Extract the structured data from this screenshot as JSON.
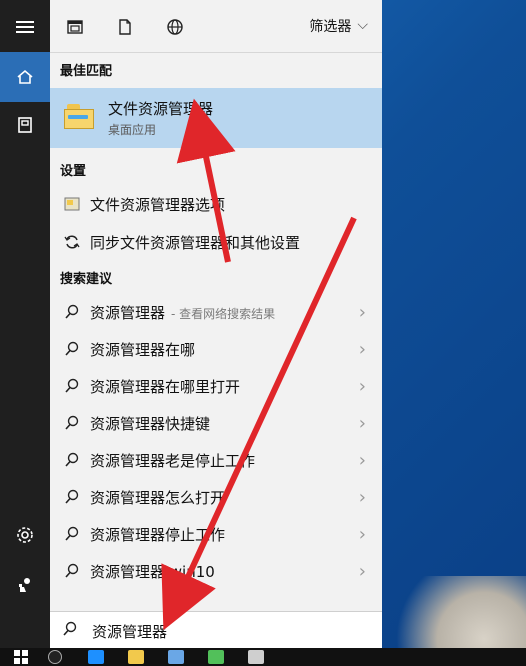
{
  "header": {
    "filter_label": "筛选器"
  },
  "sections": {
    "best_match": "最佳匹配",
    "settings": "设置",
    "search_suggestions": "搜索建议"
  },
  "best_match": {
    "title": "文件资源管理器",
    "subtitle": "桌面应用"
  },
  "settings_items": [
    {
      "label": "文件资源管理器选项"
    },
    {
      "label": "同步文件资源管理器和其他设置"
    }
  ],
  "suggestions": [
    {
      "label": "资源管理器",
      "suffix": "- 查看网络搜索结果"
    },
    {
      "label": "资源管理器在哪",
      "suffix": ""
    },
    {
      "label": "资源管理器在哪里打开",
      "suffix": ""
    },
    {
      "label": "资源管理器快捷键",
      "suffix": ""
    },
    {
      "label": "资源管理器老是停止工作",
      "suffix": ""
    },
    {
      "label": "资源管理器怎么打开",
      "suffix": ""
    },
    {
      "label": "资源管理器停止工作",
      "suffix": ""
    },
    {
      "label": "资源管理器 win10",
      "suffix": ""
    }
  ],
  "search": {
    "value": "资源管理器"
  },
  "colors": {
    "accent": "#2b6eb6",
    "selection": "#b8d6ef",
    "annotation_arrow": "#e0262a"
  }
}
